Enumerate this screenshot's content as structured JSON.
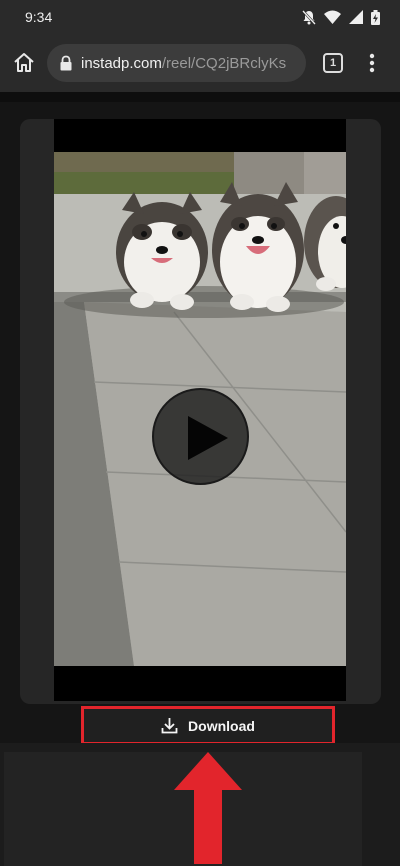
{
  "status_bar": {
    "time": "9:34",
    "icons": [
      "mute-icon",
      "wifi-icon",
      "signal-icon",
      "battery-icon"
    ]
  },
  "browser": {
    "url_host": "instadp.com",
    "url_path": "/reel/CQ2jBRclyKs",
    "tab_count": "1",
    "icons": [
      "home-icon",
      "lock-icon",
      "tab-switcher-icon",
      "more-vert-icon"
    ]
  },
  "video": {
    "icons": [
      "play-icon"
    ]
  },
  "download": {
    "label": "Download",
    "icon": "download-icon"
  },
  "colors": {
    "highlight": "#e2252c",
    "background": "#151515",
    "chrome": "#2a2a2a"
  }
}
